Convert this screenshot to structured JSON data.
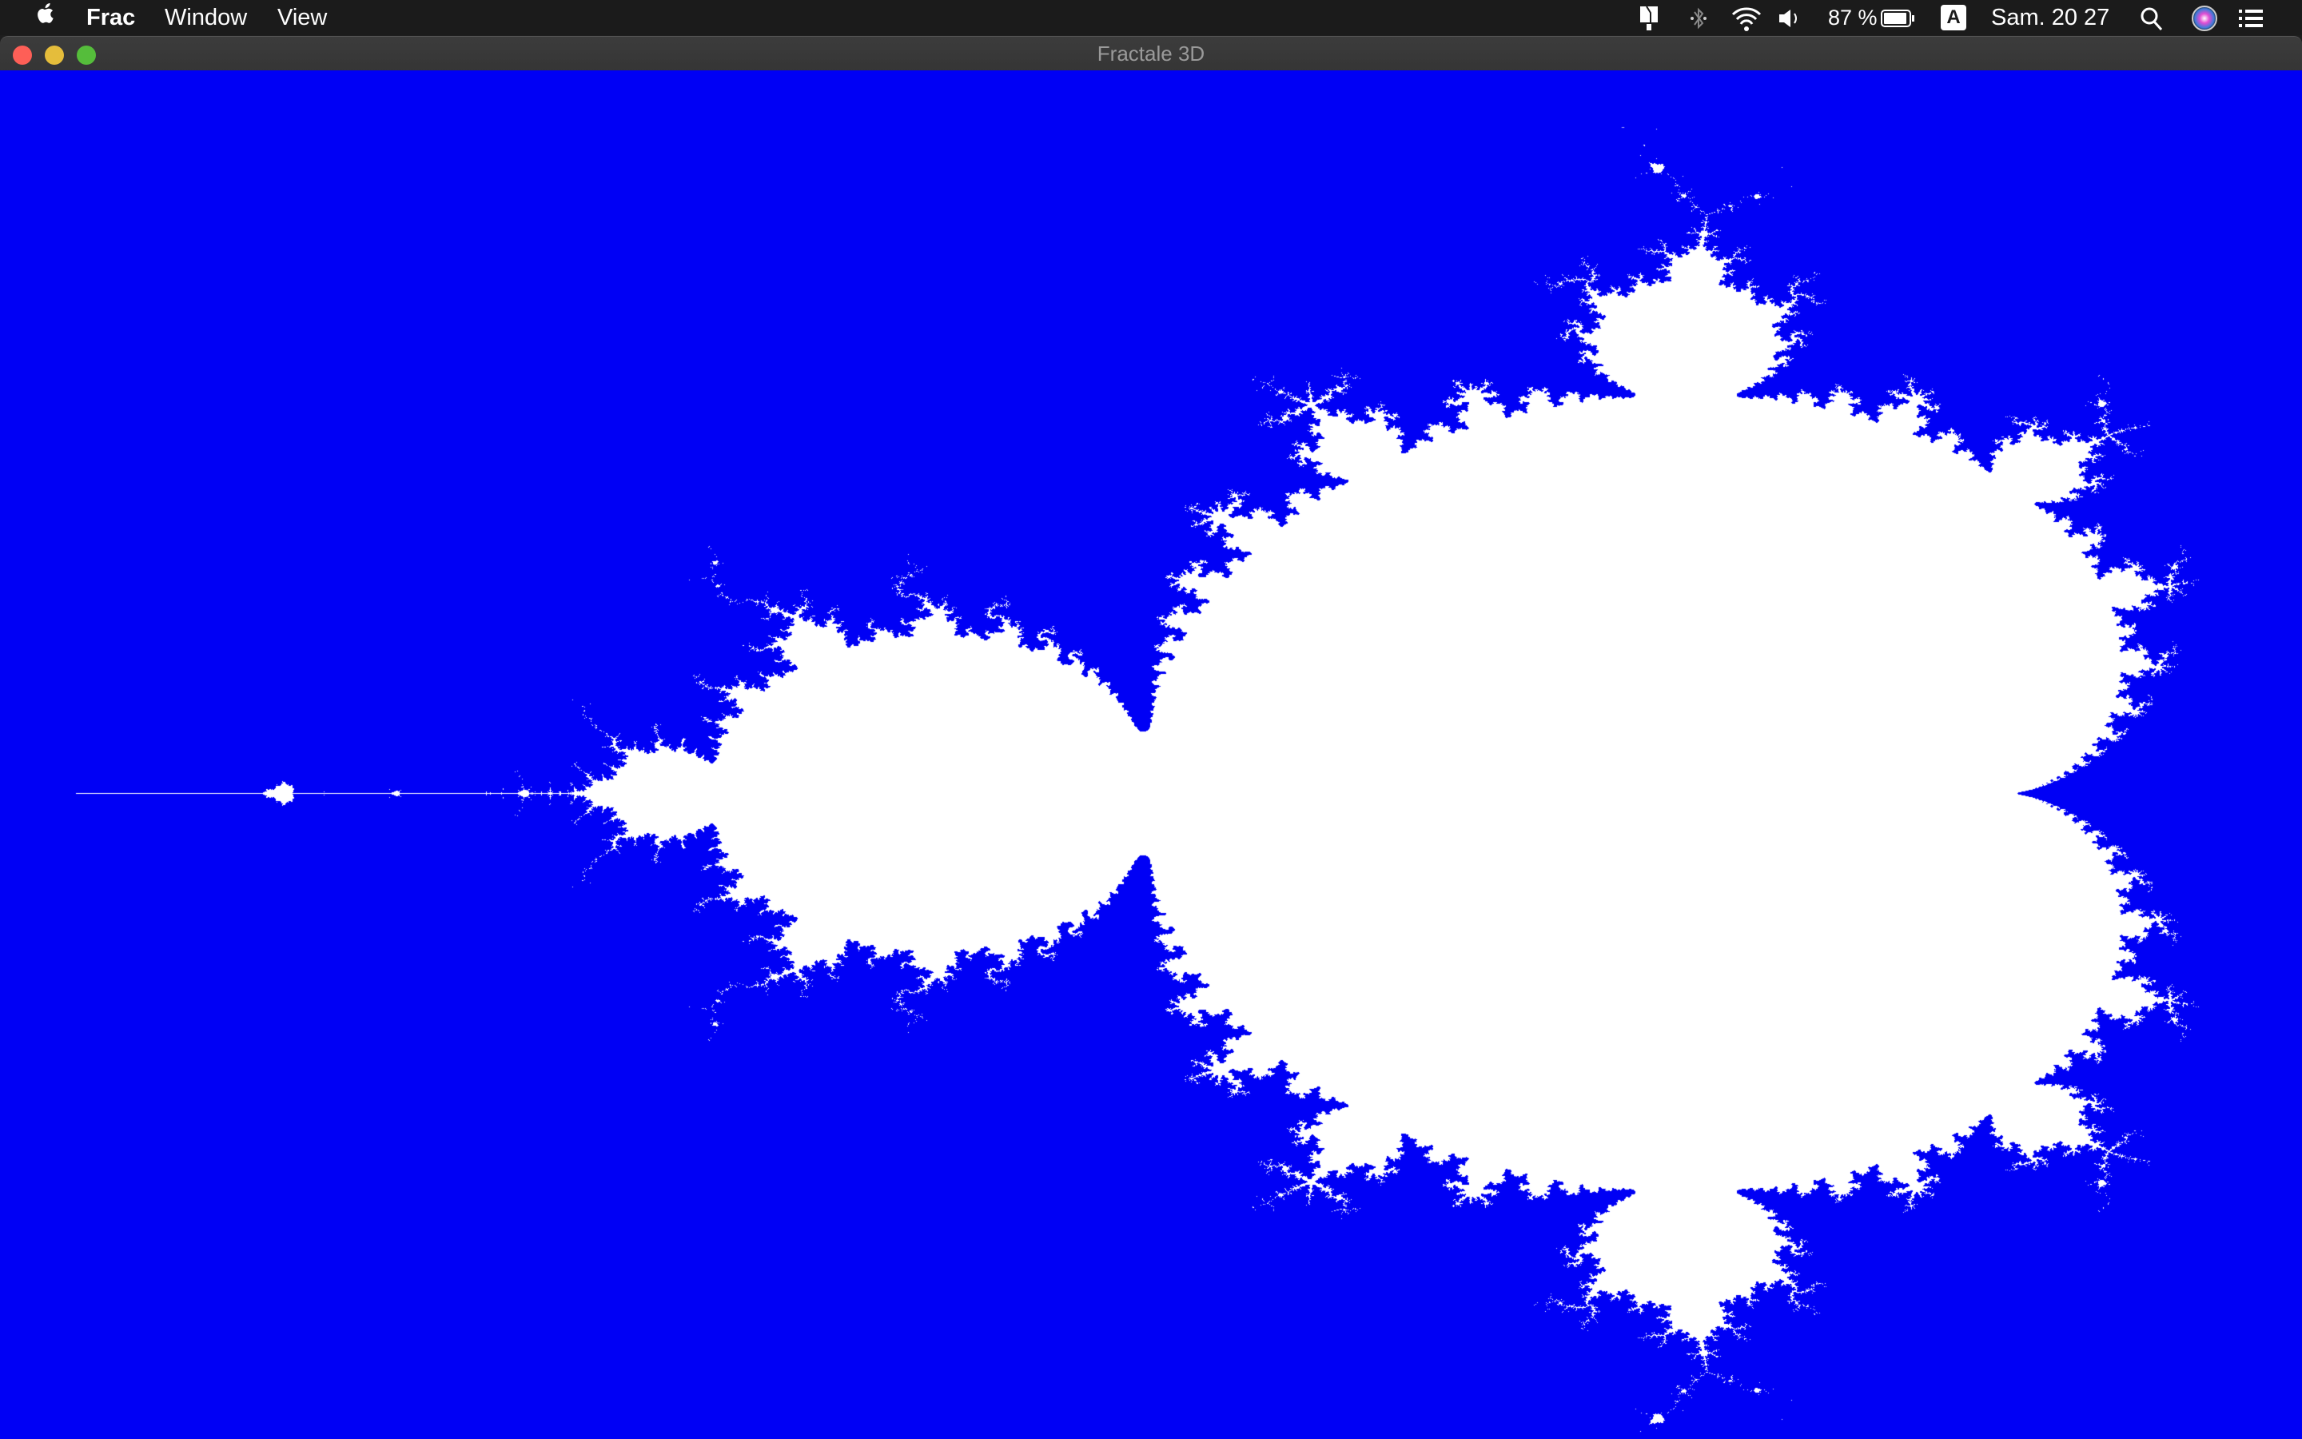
{
  "menubar": {
    "app_name": "Frac",
    "menus": [
      "Window",
      "View"
    ],
    "status": {
      "battery_percent": "87 %",
      "input_source": "A",
      "clock": "Sam. 20 27"
    }
  },
  "window": {
    "title": "Fractale 3D"
  },
  "fractal": {
    "type": "mandelbrot",
    "inside_color": "#ffffff",
    "outside_color": "#0000f5",
    "max_iterations": 30
  }
}
